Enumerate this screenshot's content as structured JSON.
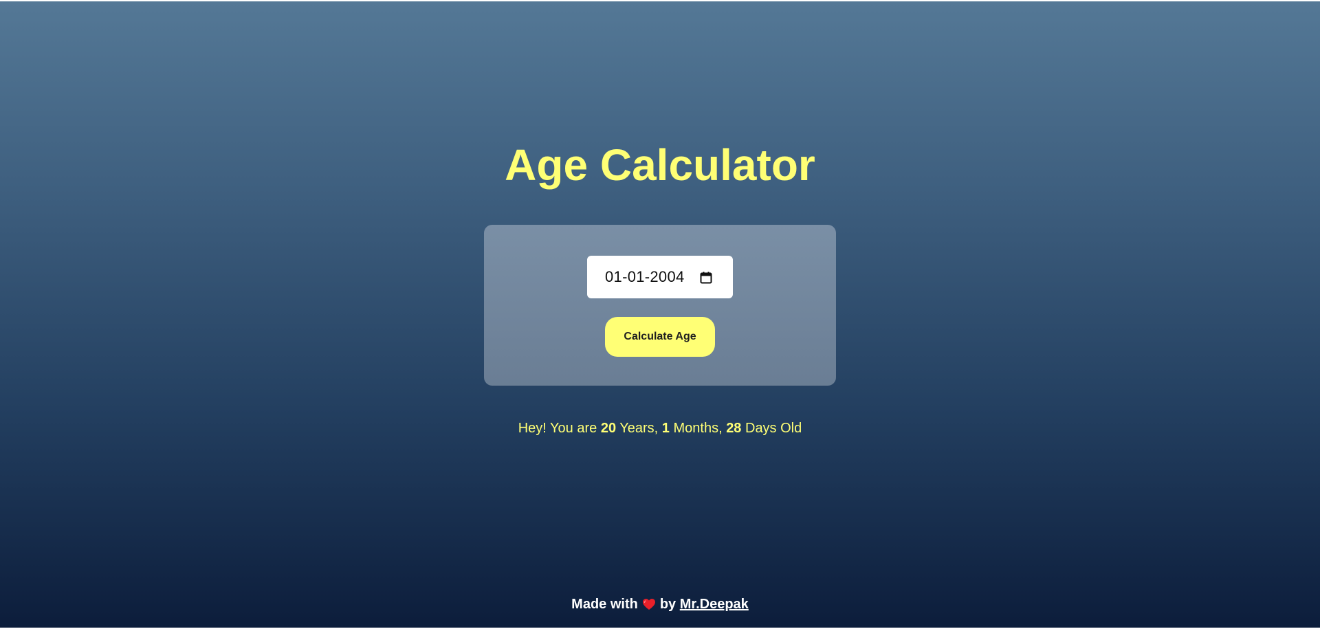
{
  "header": {
    "title": "Age Calculator"
  },
  "form": {
    "date_value": "01-01-2004",
    "calendar_icon": "calendar-icon",
    "button_label": "Calculate Age"
  },
  "result": {
    "prefix": "Hey! You are ",
    "years": "20",
    "years_label": " Years, ",
    "months": "1",
    "months_label": " Months, ",
    "days": "28",
    "days_label": " Days Old"
  },
  "footer": {
    "made_with": "Made with",
    "heart_icon": "heart-icon",
    "by": "by",
    "author": "Mr.Deepak"
  },
  "colors": {
    "accent": "#ffff75",
    "heart": "#e8202a",
    "background_top": "#547896",
    "background_bottom": "#0c1d3b"
  }
}
